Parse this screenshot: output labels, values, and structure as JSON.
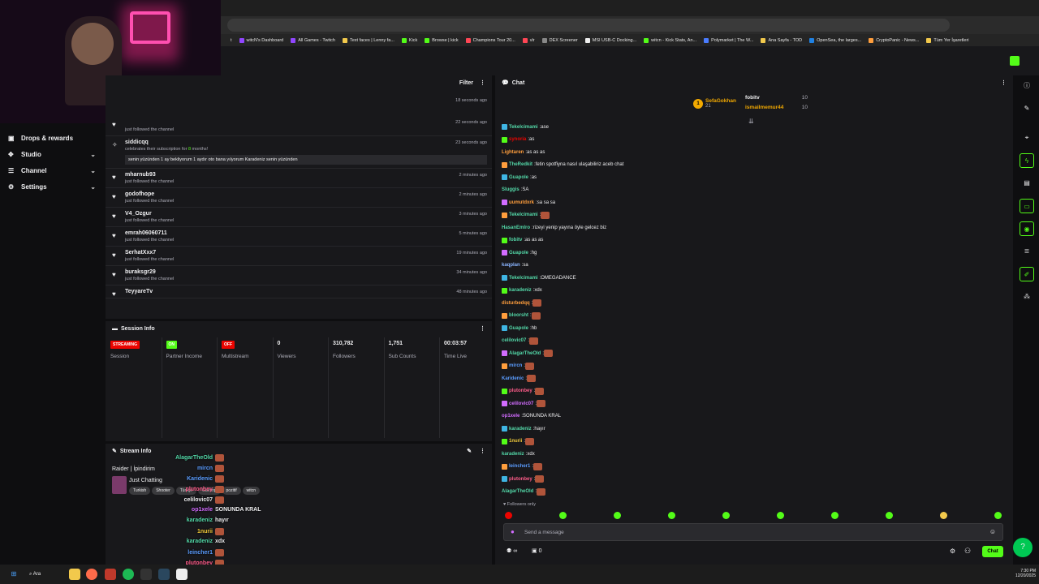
{
  "browser": {
    "bookmarks": [
      "witcN's Dashboard",
      "All Games - Twitch",
      "Text faces | Lenny fa...",
      "Kick",
      "Browse | kick",
      "Champions Tour 20...",
      "vlr",
      "DEX Screener",
      "MSI USB-C Docking...",
      "witcn - Kick Stats, An...",
      "Polymarket | The W...",
      "Ana Sayfa - TOD",
      "OpenSea, the larges...",
      "CryptoPanic - News...",
      "Tüm Yer İşaretleri"
    ],
    "partial_bookmark": "t"
  },
  "nav": [
    {
      "label": "Drops & rewards",
      "icon": "gift-icon",
      "chevron": false
    },
    {
      "label": "Studio",
      "icon": "studio-icon",
      "chevron": true
    },
    {
      "label": "Channel",
      "icon": "channel-icon",
      "chevron": true
    },
    {
      "label": "Settings",
      "icon": "gear-icon",
      "chevron": true
    }
  ],
  "activity": {
    "filter_label": "Filter",
    "top_time": "18 seconds ago",
    "items": [
      {
        "name": "",
        "sub": "just followed the channel",
        "time": "22 seconds ago"
      },
      {
        "name": "siddicqq",
        "sub_prefix": "celebrates their subscription for ",
        "sub_count": "8",
        "sub_suffix": " months!",
        "message": "senin yüzünden 1 ay bekliyorum 1 aydır oto bana yılyorum Karadeniz senin yüzünden",
        "time": "23 seconds ago"
      },
      {
        "name": "mharnub93",
        "sub": "just followed the channel",
        "time": "2 minutes ago"
      },
      {
        "name": "godofhope",
        "sub": "just followed the channel",
        "time": "2 minutes ago"
      },
      {
        "name": "V4_Ozgur",
        "sub": "just followed the channel",
        "time": "3 minutes ago"
      },
      {
        "name": "emrah06060711",
        "sub": "just followed the channel",
        "time": "5 minutes ago"
      },
      {
        "name": "SerhatXxx7",
        "sub": "just followed the channel",
        "time": "19 minutes ago"
      },
      {
        "name": "buraksgr29",
        "sub": "just followed the channel",
        "time": "34 minutes ago"
      },
      {
        "name": "TeyyareTv",
        "sub": "",
        "time": "48 minutes ago"
      }
    ]
  },
  "session": {
    "title": "Session Info",
    "stats": [
      {
        "badge": "STREAMING",
        "badge_color": "#eb0400",
        "label": "Session"
      },
      {
        "badge": "ON",
        "badge_color": "#53fc18",
        "label": "Partner Income"
      },
      {
        "badge": "OFF",
        "badge_color": "#eb0400",
        "label": "Multistream"
      },
      {
        "value": "0",
        "label": "Viewers"
      },
      {
        "value": "310,782",
        "label": "Followers"
      },
      {
        "value": "1,751",
        "label": "Sub Counts"
      },
      {
        "value": "00:03:57",
        "label": "Time Live"
      }
    ]
  },
  "stream_info": {
    "title": "Stream Info",
    "stream_title": "Raider | İpindirim",
    "category": "Just Chatting",
    "tags": [
      "Turkish",
      "Shooter",
      "Türkçe",
      "Gaming",
      "pozitif",
      "witcn"
    ]
  },
  "overlay_chat": [
    {
      "user": "AlagarTheOld",
      "color": "#53d8a8",
      "text": ""
    },
    {
      "user": "mircn",
      "color": "#5b9dff",
      "text": ""
    },
    {
      "user": "Karidenic",
      "color": "#5b9dff",
      "text": ""
    },
    {
      "user": "plutonbey",
      "color": "#ff5c8a",
      "text": ""
    },
    {
      "user": "celilovic07",
      "color": "#efeff1",
      "text": ""
    },
    {
      "user": "op1xele",
      "color": "#d26cff",
      "text": "SONUNDA KRAL"
    },
    {
      "user": "karadeniz",
      "color": "#53d8a8",
      "text": "hayır"
    },
    {
      "user": "1nurii",
      "color": "#f0c93a",
      "text": ""
    },
    {
      "user": "karadeniz",
      "color": "#53d8a8",
      "text": "xdx"
    },
    {
      "user": "leincher1",
      "color": "#5b9dff",
      "text": ""
    },
    {
      "user": "plutonbey",
      "color": "#ff5c8a",
      "text": ""
    },
    {
      "user": "AlagarTheOld",
      "color": "#53d8a8",
      "text": ""
    }
  ],
  "chat": {
    "title": "Chat",
    "gifters": [
      {
        "name": "SefaGokhan",
        "count": "21"
      },
      {
        "name": "fobitv",
        "count": "10"
      },
      {
        "name": "ismailmemur44",
        "count": "10"
      }
    ],
    "messages": [
      {
        "user": "Tekelcimami",
        "color": "#53d8a8",
        "text": "ase"
      },
      {
        "user": "synoria",
        "color": "#eb0400",
        "text": "as"
      },
      {
        "user": "Lightaren",
        "color": "#ff9e3d",
        "text": "as as as"
      },
      {
        "user": "TheRedkit",
        "color": "#53d8a8",
        "text": "fetin spotfiyna nasıl ulaşabiliriz aceb chat"
      },
      {
        "user": "Guapole",
        "color": "#53d8a8",
        "text": "as"
      },
      {
        "user": "Sluggis",
        "color": "#53d8a8",
        "text": "SA"
      },
      {
        "user": "uumutdxrk",
        "color": "#ff9e3d",
        "text": "sa sa sa"
      },
      {
        "user": "Tekelcimami",
        "color": "#53d8a8",
        "text": ""
      },
      {
        "user": "HasanEmlro",
        "color": "#53d8a8",
        "text": "rizeyi yenip yayına öyle gelcez biz"
      },
      {
        "user": "fobitv",
        "color": "#53d8a8",
        "text": "as as as"
      },
      {
        "user": "Guapole",
        "color": "#53d8a8",
        "text": "hg"
      },
      {
        "user": "kaqplan",
        "color": "#8ab4ff",
        "text": "sa"
      },
      {
        "user": "Tekelcimami",
        "color": "#53d8a8",
        "text": "OMEGADANCE"
      },
      {
        "user": "karadeniz",
        "color": "#53d8a8",
        "text": "xdx"
      },
      {
        "user": "disturbedqq",
        "color": "#ff9e3d",
        "text": ""
      },
      {
        "user": "bloorsht",
        "color": "#53d8a8",
        "text": ""
      },
      {
        "user": "Guapole",
        "color": "#53d8a8",
        "text": "hb"
      },
      {
        "user": "celilovic07",
        "color": "#53d8a8",
        "text": ""
      },
      {
        "user": "AlagarTheOld",
        "color": "#53d8a8",
        "text": ""
      },
      {
        "user": "mircn",
        "color": "#5b9dff",
        "text": ""
      },
      {
        "user": "Karidenic",
        "color": "#5b9dff",
        "text": ""
      },
      {
        "user": "plutonbey",
        "color": "#ff5c8a",
        "text": ""
      },
      {
        "user": "celilovic07",
        "color": "#d26cff",
        "text": ""
      },
      {
        "user": "op1xele",
        "color": "#d26cff",
        "text": "SONUNDA KRAL"
      },
      {
        "user": "karadeniz",
        "color": "#53d8a8",
        "text": "hayır"
      },
      {
        "user": "1nurii",
        "color": "#f0c93a",
        "text": ""
      },
      {
        "user": "karadeniz",
        "color": "#53d8a8",
        "text": "xdx"
      },
      {
        "user": "leincher1",
        "color": "#5b9dff",
        "text": ""
      },
      {
        "user": "plutonbey",
        "color": "#ff5c8a",
        "text": ""
      },
      {
        "user": "AlagarTheOld",
        "color": "#53d8a8",
        "text": ""
      }
    ],
    "followers_only": "Followers only",
    "input_placeholder": "Send a message",
    "viewer_counter": "∞",
    "gift_count": "0",
    "send_label": "Chat"
  },
  "taskbar": {
    "search_label": "Ara",
    "time": "7:30 PM",
    "date": "12/20/2025"
  },
  "colors": {
    "accent": "#53fc18",
    "alert": "#eb0400"
  }
}
